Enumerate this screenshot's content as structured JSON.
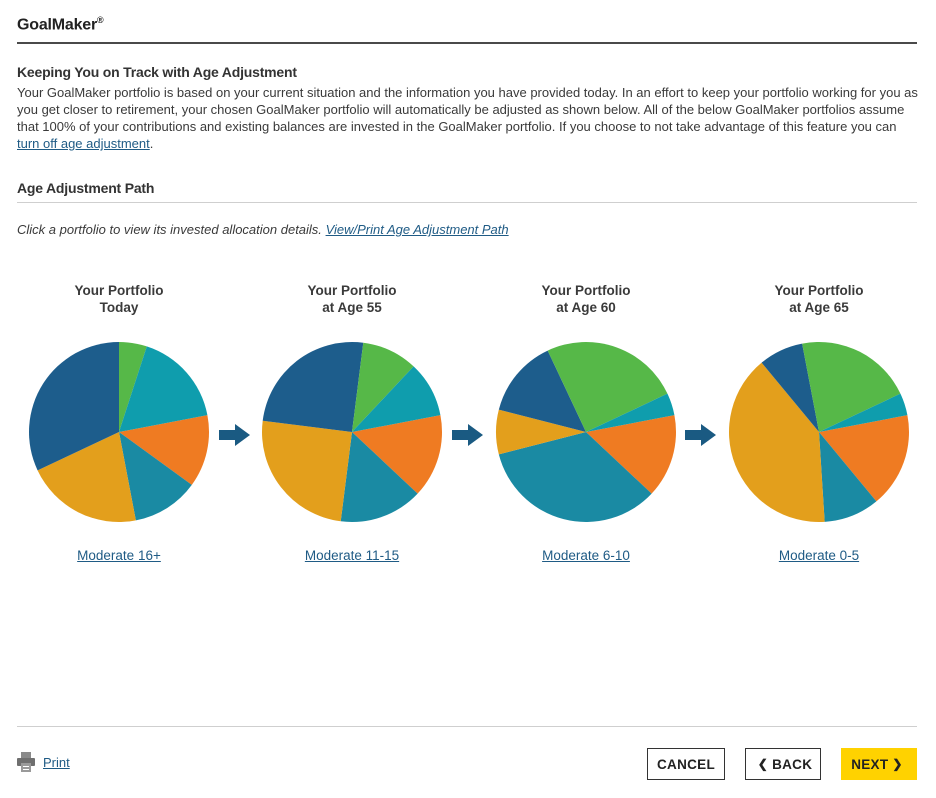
{
  "app": {
    "title": "GoalMaker",
    "trademark": "®"
  },
  "intro": {
    "heading": "Keeping You on Track with Age Adjustment",
    "paragraph": "Your GoalMaker portfolio is based on your current situation and the information you have provided today. In an effort to keep your portfolio working for you as you get closer to retirement, your chosen GoalMaker portfolio will automatically be adjusted as shown below. All of the below GoalMaker portfolios assume that 100% of your contributions and existing balances are invested in the GoalMaker portfolio. If you choose to not take advantage of this feature you can ",
    "link": "turn off age adjustment",
    "end": "."
  },
  "path": {
    "heading": "Age Adjustment Path",
    "instruction": "Click a portfolio to view its invested allocation details.",
    "print_link": "View/Print Age Adjustment Path"
  },
  "colors": {
    "orange": "#ef7b22",
    "teal_blue": "#1a8aa3",
    "gold": "#e39f1c",
    "dark_blue": "#1d5d8c",
    "green": "#56b848",
    "cyan": "#0f9dad",
    "arrow": "#1a5a82",
    "accent": "#ffd200",
    "link": "#1f5b85"
  },
  "portfolios": [
    {
      "title_line1": "Your Portfolio",
      "title_line2": "Today",
      "label": "Moderate 16+",
      "slices": [
        {
          "color": "orange",
          "percent": 13
        },
        {
          "color": "teal_blue",
          "percent": 12
        },
        {
          "color": "gold",
          "percent": 21
        },
        {
          "color": "dark_blue",
          "percent": 32
        },
        {
          "color": "green",
          "percent": 5
        },
        {
          "color": "cyan",
          "percent": 17
        }
      ]
    },
    {
      "title_line1": "Your Portfolio",
      "title_line2": "at Age 55",
      "label": "Moderate 11-15",
      "slices": [
        {
          "color": "orange",
          "percent": 15
        },
        {
          "color": "teal_blue",
          "percent": 15
        },
        {
          "color": "gold",
          "percent": 25
        },
        {
          "color": "dark_blue",
          "percent": 25
        },
        {
          "color": "green",
          "percent": 10
        },
        {
          "color": "cyan",
          "percent": 10
        }
      ]
    },
    {
      "title_line1": "Your Portfolio",
      "title_line2": "at Age 60",
      "label": "Moderate 6-10",
      "slices": [
        {
          "color": "orange",
          "percent": 15
        },
        {
          "color": "teal_blue",
          "percent": 34
        },
        {
          "color": "gold",
          "percent": 8
        },
        {
          "color": "dark_blue",
          "percent": 14
        },
        {
          "color": "green",
          "percent": 25
        },
        {
          "color": "cyan",
          "percent": 4
        }
      ]
    },
    {
      "title_line1": "Your Portfolio",
      "title_line2": "at Age 65",
      "label": "Moderate 0-5",
      "slices": [
        {
          "color": "orange",
          "percent": 17
        },
        {
          "color": "teal_blue",
          "percent": 10
        },
        {
          "color": "gold",
          "percent": 40
        },
        {
          "color": "dark_blue",
          "percent": 8
        },
        {
          "color": "green",
          "percent": 21
        },
        {
          "color": "cyan",
          "percent": 4
        }
      ]
    }
  ],
  "footer": {
    "print": "Print",
    "cancel": "CANCEL",
    "back": "BACK",
    "next": "NEXT"
  }
}
